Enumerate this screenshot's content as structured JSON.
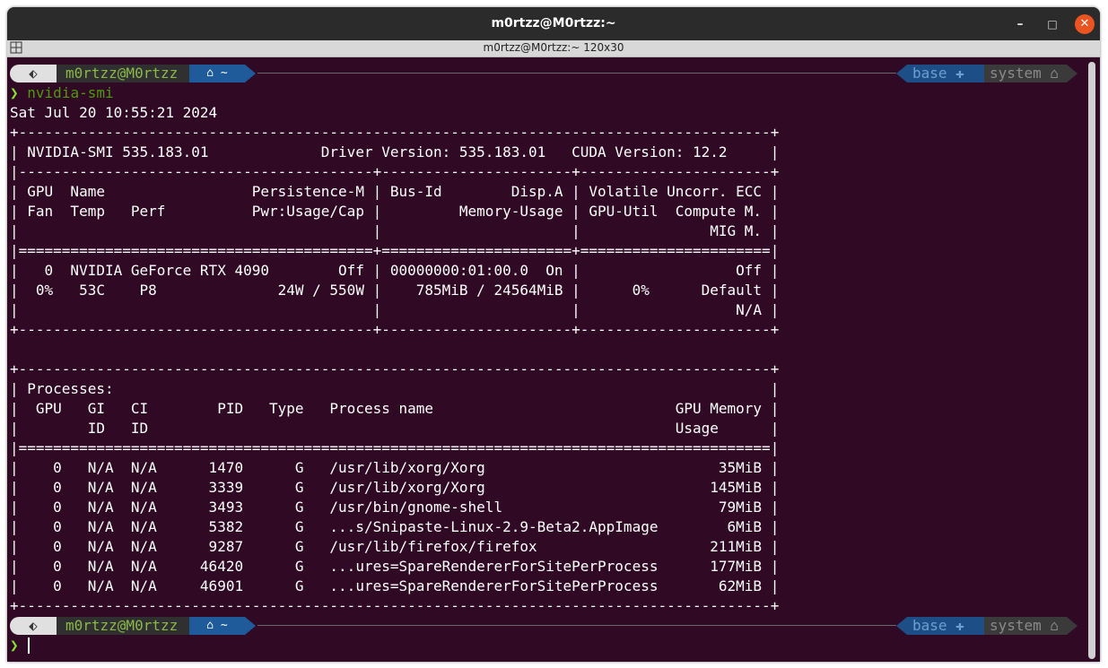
{
  "window": {
    "title": "m0rtzz@M0rtzz:~",
    "subtitle": "m0rtzz@M0rtzz:~ 120x30",
    "minimize_glyph": "–",
    "maximize_glyph": "□",
    "close_glyph": "✕"
  },
  "prompt": {
    "os_icon": "⬖",
    "user_host": "m0rtzz@M0rtzz",
    "dir": "⌂ ~",
    "env_label": "base ✚",
    "context_label": "system ⌂",
    "chevron": "❯"
  },
  "command": "nvidia-smi",
  "output": [
    "Sat Jul 20 10:55:21 2024",
    "+---------------------------------------------------------------------------------------+",
    "| NVIDIA-SMI 535.183.01             Driver Version: 535.183.01   CUDA Version: 12.2     |",
    "|-----------------------------------------+----------------------+----------------------+",
    "| GPU  Name                 Persistence-M | Bus-Id        Disp.A | Volatile Uncorr. ECC |",
    "| Fan  Temp   Perf          Pwr:Usage/Cap |         Memory-Usage | GPU-Util  Compute M. |",
    "|                                         |                      |               MIG M. |",
    "|=========================================+======================+======================|",
    "|   0  NVIDIA GeForce RTX 4090        Off | 00000000:01:00.0  On |                  Off |",
    "|  0%   53C    P8              24W / 550W |    785MiB / 24564MiB |      0%      Default |",
    "|                                         |                      |                  N/A |",
    "+-----------------------------------------+----------------------+----------------------+",
    "",
    "+---------------------------------------------------------------------------------------+",
    "| Processes:                                                                            |",
    "|  GPU   GI   CI        PID   Type   Process name                            GPU Memory |",
    "|        ID   ID                                                             Usage      |",
    "|=======================================================================================|",
    "|    0   N/A  N/A      1470      G   /usr/lib/xorg/Xorg                           35MiB |",
    "|    0   N/A  N/A      3339      G   /usr/lib/xorg/Xorg                          145MiB |",
    "|    0   N/A  N/A      3493      G   /usr/bin/gnome-shell                         79MiB |",
    "|    0   N/A  N/A      5382      G   ...s/Snipaste-Linux-2.9-Beta2.AppImage        6MiB |",
    "|    0   N/A  N/A      9287      G   /usr/lib/firefox/firefox                    211MiB |",
    "|    0   N/A  N/A     46420      G   ...ures=SpareRendererForSitePerProcess      177MiB |",
    "|    0   N/A  N/A     46901      G   ...ures=SpareRendererForSitePerProcess       62MiB |",
    "+---------------------------------------------------------------------------------------+"
  ],
  "colors": {
    "terminal_bg": "#300a24",
    "prompt_green": "#8ab84a",
    "command_green": "#4e9a06",
    "dir_blue": "#1f5a9a",
    "close_orange": "#e95420"
  },
  "icons": [
    "menu-icon",
    "minimize-icon",
    "maximize-icon",
    "close-icon",
    "os-logo-icon",
    "home-icon",
    "conda-icon",
    "system-icon"
  ]
}
